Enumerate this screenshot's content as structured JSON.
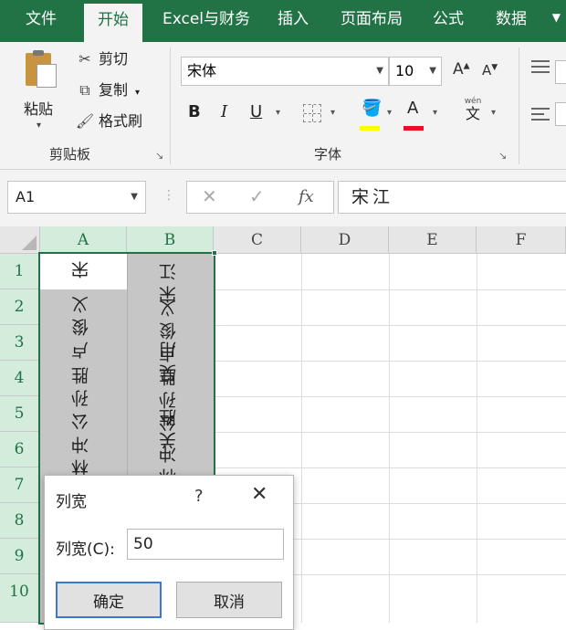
{
  "tabs": [
    {
      "label": "文件"
    },
    {
      "label": "开始"
    },
    {
      "label": "Excel与财务"
    },
    {
      "label": "插入"
    },
    {
      "label": "页面布局"
    },
    {
      "label": "公式"
    },
    {
      "label": "数据"
    }
  ],
  "clipboard": {
    "paste_label": "粘贴",
    "cut_label": "剪切",
    "copy_label": "复制",
    "format_painter_label": "格式刷",
    "group_label": "剪贴板"
  },
  "font": {
    "family": "宋体",
    "size": "10",
    "group_label": "字体",
    "grow_label": "A",
    "shrink_label": "A",
    "bold_label": "B",
    "italic_label": "I",
    "underline_label": "U",
    "font_color_label": "A",
    "phonetic_label": "wén",
    "phonetic_char": "文",
    "fill_color": "#ffff00",
    "font_color": "#e81123"
  },
  "formula_bar": {
    "name_box": "A1",
    "fx_label": "fx",
    "value": "宋江"
  },
  "grid": {
    "columns": [
      "A",
      "B",
      "C",
      "D",
      "E",
      "F"
    ],
    "rows": [
      "1",
      "2",
      "3",
      "4",
      "5",
      "6",
      "7",
      "8",
      "9",
      "10"
    ],
    "cells": {
      "a1": "宋",
      "a2": "卢俊义",
      "a4": "公孙胜",
      "a6": "林冲",
      "b1": "宋江",
      "b2": "卢俊义",
      "b4": "吴用",
      "b5": "公孙胜",
      "b6": "关胜",
      "b7": "林冲"
    }
  },
  "dialog": {
    "title": "列宽",
    "help": "?",
    "label": "列宽(C):",
    "value": "50",
    "ok_label": "确定",
    "cancel_label": "取消"
  },
  "colors": {
    "brand": "#217346",
    "selection": "#c6c6c6",
    "header_selected": "#d3ecdc"
  }
}
